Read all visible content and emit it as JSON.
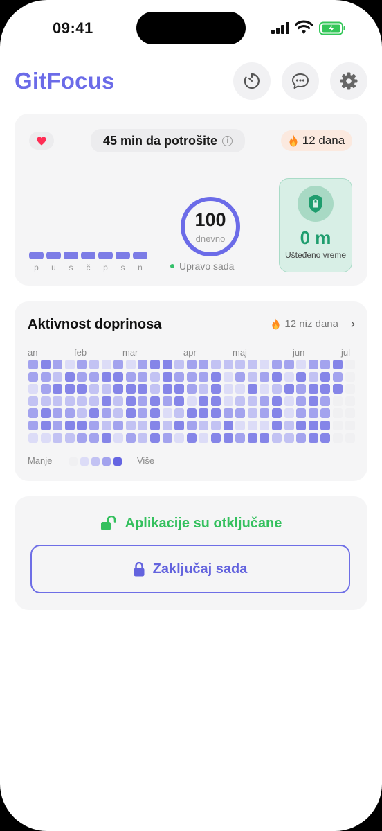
{
  "status_bar": {
    "time": "09:41"
  },
  "app": {
    "title": "GitFocus"
  },
  "header_buttons": [
    {
      "icon": "timer-icon"
    },
    {
      "icon": "chat-icon"
    },
    {
      "icon": "gear-icon"
    }
  ],
  "budget_card": {
    "heart_icon": "heart-icon",
    "budget_text": "45 min da potrošite",
    "info_glyph": "i",
    "streak_text": "12 dana",
    "weekdays": [
      "p",
      "u",
      "s",
      "č",
      "p",
      "s",
      "n"
    ],
    "score_value": "100",
    "score_unit": "dnevno",
    "score_progress": 1.0,
    "updated_text": "Upravo sada",
    "saved_value": "0 m",
    "saved_label": "Ušteđeno vreme"
  },
  "activity_card": {
    "title": "Aktivnost doprinosa",
    "streak_text": "12 niz dana",
    "months": [
      "an",
      "feb",
      "mar",
      "apr",
      "maj",
      "jun",
      "jul"
    ],
    "legend_less": "Manje",
    "legend_more": "Više"
  },
  "lock_card": {
    "status_text": "Aplikacije su otključane",
    "lock_button_label": "Zaključaj sada"
  },
  "colors": {
    "accent": "#6b6be8",
    "green": "#34c05e",
    "teal": "#1f9d6e",
    "levels": [
      "#f0f0f2",
      "#dcdcf7",
      "#c2c2f3",
      "#a3a3ee",
      "#8585e8"
    ]
  }
}
